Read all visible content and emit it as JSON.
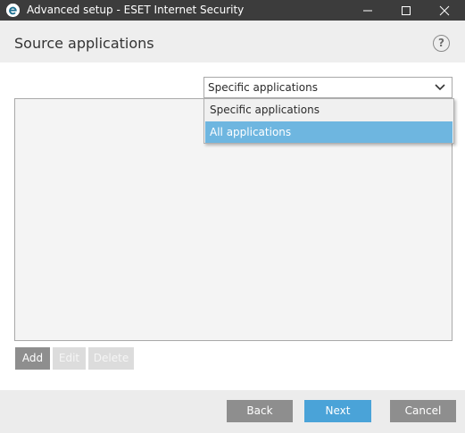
{
  "window": {
    "title": "Advanced setup - ESET Internet Security",
    "accent_color": "#4aa3d8"
  },
  "header": {
    "title": "Source applications",
    "help_label": "?"
  },
  "source_select": {
    "selected": "Specific applications",
    "options": [
      {
        "label": "Specific applications",
        "highlighted": false
      },
      {
        "label": "All applications",
        "highlighted": true
      }
    ]
  },
  "list_actions": {
    "add_label": "Add",
    "edit_label": "Edit",
    "delete_label": "Delete"
  },
  "footer": {
    "back_label": "Back",
    "next_label": "Next",
    "cancel_label": "Cancel"
  }
}
